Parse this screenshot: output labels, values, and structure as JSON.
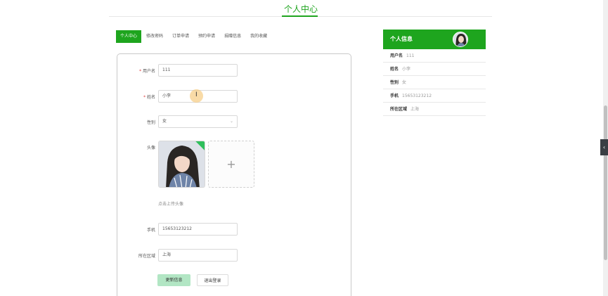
{
  "header": {
    "title": "个人中心"
  },
  "tabs": [
    {
      "label": "个人中心"
    },
    {
      "label": "修改密码"
    },
    {
      "label": "订单申请"
    },
    {
      "label": "预约申请"
    },
    {
      "label": "捐赠信息"
    },
    {
      "label": "我的收藏"
    }
  ],
  "form": {
    "username": {
      "label": "用户名",
      "value": "111"
    },
    "name": {
      "label": "姓名",
      "value": "小李"
    },
    "gender": {
      "label": "性别",
      "value": "女"
    },
    "avatar": {
      "label": "头像",
      "hint": "点击上传头像",
      "plus": "+"
    },
    "phone": {
      "label": "手机",
      "value": "15653123212"
    },
    "region": {
      "label": "所在区域",
      "value": "上海"
    },
    "required_mark": "*",
    "update_button": "更新信息",
    "logout_button": "退出登录"
  },
  "info_panel": {
    "title": "个人信息",
    "rows": [
      {
        "key": "用户名",
        "value": "111"
      },
      {
        "key": "姓名",
        "value": "小李"
      },
      {
        "key": "性别",
        "value": "女"
      },
      {
        "key": "手机",
        "value": "15653123212"
      },
      {
        "key": "所在区域",
        "value": "上海"
      }
    ]
  },
  "colors": {
    "accent": "#1ea51e",
    "update_button": "#b2e6c4",
    "required": "#e04040"
  },
  "icons": {
    "select_arrow": "chevron-down-icon",
    "side_toggle": "chevron-left-icon",
    "cursor": "text-cursor-icon"
  }
}
